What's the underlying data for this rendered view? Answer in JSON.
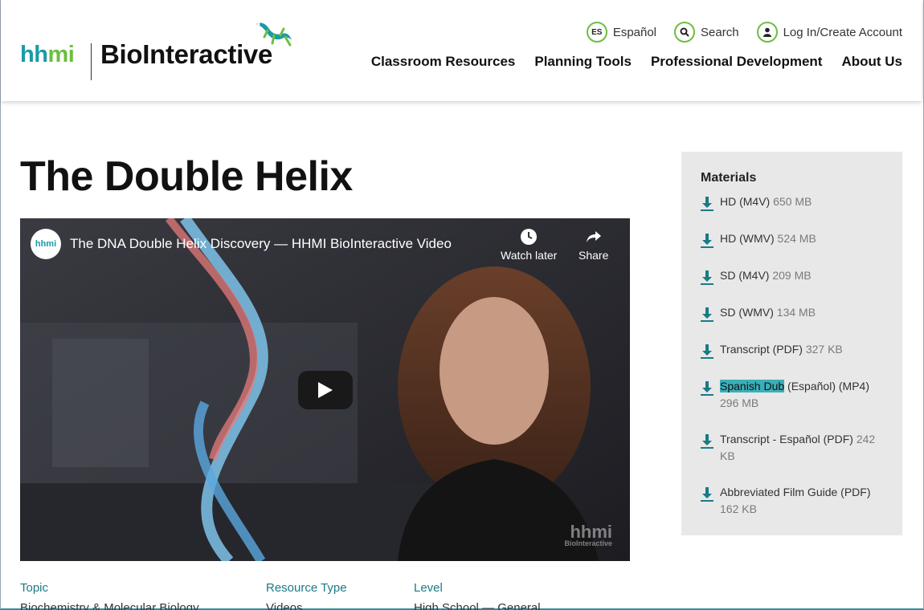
{
  "header": {
    "logo_hhmi": "hhmi",
    "logo_bio": "BioInteractive",
    "util": {
      "lang_badge": "ES",
      "lang_label": "Español",
      "search_label": "Search",
      "login_label": "Log In/Create Account"
    },
    "nav": [
      "Classroom Resources",
      "Planning Tools",
      "Professional Development",
      "About Us"
    ]
  },
  "page": {
    "title": "The Double Helix"
  },
  "video": {
    "channel_badge": "hhmi",
    "title": "The DNA Double Helix Discovery — HHMI BioInteractive Video",
    "watch_later": "Watch later",
    "share": "Share",
    "watermark_top": "hhmi",
    "watermark_bottom": "BioInteractive"
  },
  "materials": {
    "heading": "Materials",
    "items": [
      {
        "label": "HD (M4V)",
        "size": "650 MB"
      },
      {
        "label": "HD (WMV)",
        "size": "524 MB"
      },
      {
        "label": "SD (M4V)",
        "size": "209 MB"
      },
      {
        "label": "SD (WMV)",
        "size": "134 MB"
      },
      {
        "label": "Transcript (PDF)",
        "size": "327 KB"
      },
      {
        "label_highlight": "Spanish Dub",
        "label": " (Español) (MP4)",
        "size": "296 MB"
      },
      {
        "label": "Transcript - Español (PDF)",
        "size": "242 KB"
      },
      {
        "label": "Abbreviated Film Guide (PDF)",
        "size": "162 KB"
      }
    ]
  },
  "meta": {
    "topic_label": "Topic",
    "topic_value": "Biochemistry & Molecular Biology",
    "type_label": "Resource Type",
    "type_value": "Videos",
    "level_label": "Level",
    "level_value": "High School — General"
  },
  "colors": {
    "accent_teal": "#1a9aa8",
    "accent_green": "#6cbf3f",
    "highlight": "#3aafb9",
    "panel_bg": "#e8e8e8"
  }
}
